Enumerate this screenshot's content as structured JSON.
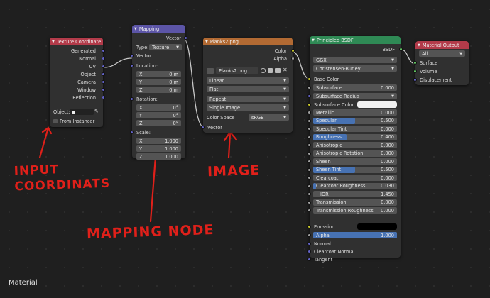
{
  "editor": {
    "label": "Material"
  },
  "nodes": {
    "texcoord": {
      "title": "Texture Coordinate",
      "outputs": [
        "Generated",
        "Normal",
        "UV",
        "Object",
        "Camera",
        "Window",
        "Reflection"
      ],
      "object_label": "Object:",
      "from_instancer": "From Instancer"
    },
    "mapping": {
      "title": "Mapping",
      "output": "Vector",
      "type_label": "Type:",
      "type_value": "Texture",
      "vector_input": "Vector",
      "location_label": "Location:",
      "location": [
        {
          "axis": "X",
          "value": "0 m"
        },
        {
          "axis": "Y",
          "value": "0 m"
        },
        {
          "axis": "Z",
          "value": "0 m"
        }
      ],
      "rotation_label": "Rotation:",
      "rotation": [
        {
          "axis": "X",
          "value": "0°"
        },
        {
          "axis": "Y",
          "value": "0°"
        },
        {
          "axis": "Z",
          "value": "0°"
        }
      ],
      "scale_label": "Scale:",
      "scale": [
        {
          "axis": "X",
          "value": "1.000"
        },
        {
          "axis": "Y",
          "value": "1.000"
        },
        {
          "axis": "Z",
          "value": "1.000"
        }
      ]
    },
    "image": {
      "title": "Planks2.png",
      "out_color": "Color",
      "out_alpha": "Alpha",
      "image_name": "Planks2.png",
      "interpolation": "Linear",
      "projection": "Flat",
      "extension": "Repeat",
      "source": "Single Image",
      "colorspace_label": "Color Space",
      "colorspace": "sRGB",
      "vector_input": "Vector"
    },
    "bsdf": {
      "title": "Principled BSDF",
      "output": "BSDF",
      "distribution": "GGX",
      "subsurface_method": "Christensen-Burley",
      "base_color": "Base Color",
      "subsurface": {
        "label": "Subsurface",
        "value": "0.000"
      },
      "subsurface_radius": "Subsurface Radius",
      "subsurface_color": "Subsurface Color",
      "params": [
        {
          "label": "Metallic",
          "value": "0.000",
          "fill": 0
        },
        {
          "label": "Specular",
          "value": "0.500",
          "fill": 0.5
        },
        {
          "label": "Specular Tint",
          "value": "0.000",
          "fill": 0
        },
        {
          "label": "Roughness",
          "value": "0.400",
          "fill": 0.4
        },
        {
          "label": "Anisotropic",
          "value": "0.000",
          "fill": 0
        },
        {
          "label": "Anisotropic Rotation",
          "value": "0.000",
          "fill": 0
        },
        {
          "label": "Sheen",
          "value": "0.000",
          "fill": 0
        },
        {
          "label": "Sheen Tint",
          "value": "0.500",
          "fill": 0.5
        },
        {
          "label": "Clearcoat",
          "value": "0.000",
          "fill": 0
        },
        {
          "label": "Clearcoat Roughness",
          "value": "0.030",
          "fill": 0.03
        },
        {
          "label": "IOR",
          "value": "1.450",
          "fill": 0
        },
        {
          "label": "Transmission",
          "value": "0.000",
          "fill": 0
        },
        {
          "label": "Transmission Roughness",
          "value": "0.000",
          "fill": 0
        }
      ],
      "emission": "Emission",
      "alpha": {
        "label": "Alpha",
        "value": "1.000",
        "fill": 1
      },
      "normal": "Normal",
      "clearcoat_normal": "Clearcoat Normal",
      "tangent": "Tangent"
    },
    "output": {
      "title": "Material Output",
      "target": "All",
      "inputs": [
        "Surface",
        "Volume",
        "Displacement"
      ]
    }
  },
  "annotations": {
    "input": [
      "INPUT",
      "COORDINATS"
    ],
    "mapping": "MAPPING NODE",
    "image": "IMAGE"
  },
  "colors": {
    "input_header": "#b33b4a",
    "vector_header": "#5c55a7",
    "texture_header": "#b26a33",
    "shader_header": "#2f8a55",
    "output_header": "#b33b4a",
    "annotation": "#e0201a"
  }
}
